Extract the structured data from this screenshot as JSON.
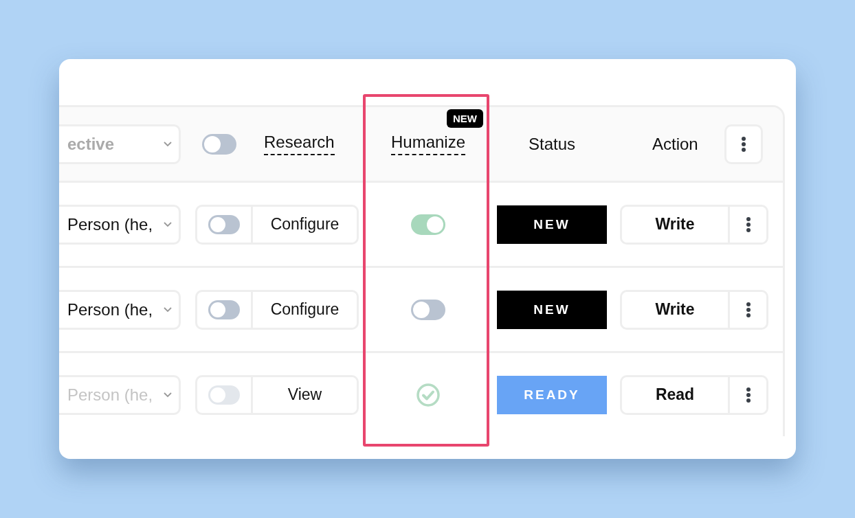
{
  "header": {
    "perspective_placeholder": "ective",
    "research_toggle_on": false,
    "research_label": "Research",
    "humanize_label": "Humanize",
    "humanize_badge": "NEW",
    "humanize_highlighted": true,
    "status_label": "Status",
    "action_label": "Action"
  },
  "rows": [
    {
      "perspective": "Person (he,",
      "disabled": false,
      "research_on": false,
      "research_button": "Configure",
      "humanize": {
        "kind": "toggle",
        "on": true
      },
      "status": {
        "kind": "new",
        "label": "NEW"
      },
      "action": "Write"
    },
    {
      "perspective": "Person (he,",
      "disabled": false,
      "research_on": false,
      "research_button": "Configure",
      "humanize": {
        "kind": "toggle",
        "on": false
      },
      "status": {
        "kind": "new",
        "label": "NEW"
      },
      "action": "Write"
    },
    {
      "perspective": "Person (he,",
      "disabled": true,
      "research_on": false,
      "research_button": "View",
      "humanize": {
        "kind": "done"
      },
      "status": {
        "kind": "ready",
        "label": "READY"
      },
      "action": "Read"
    }
  ]
}
